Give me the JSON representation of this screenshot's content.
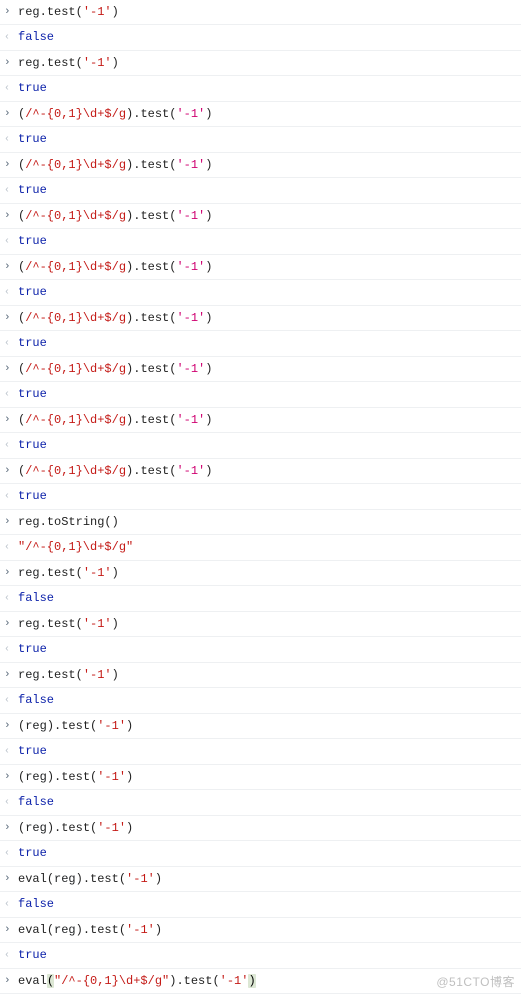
{
  "watermark": "@51CTO博客",
  "lines": [
    {
      "dir": "in",
      "parts": [
        {
          "t": "ident",
          "v": "reg"
        },
        {
          "t": "dot",
          "v": "."
        },
        {
          "t": "method",
          "v": "test"
        },
        {
          "t": "paren",
          "v": "("
        },
        {
          "t": "string-red",
          "v": "'-1'"
        },
        {
          "t": "paren",
          "v": ")"
        }
      ]
    },
    {
      "dir": "out",
      "parts": [
        {
          "t": "kw-false",
          "v": "false"
        }
      ]
    },
    {
      "dir": "in",
      "parts": [
        {
          "t": "ident",
          "v": "reg"
        },
        {
          "t": "dot",
          "v": "."
        },
        {
          "t": "method",
          "v": "test"
        },
        {
          "t": "paren",
          "v": "("
        },
        {
          "t": "string-red",
          "v": "'-1'"
        },
        {
          "t": "paren",
          "v": ")"
        }
      ]
    },
    {
      "dir": "out",
      "parts": [
        {
          "t": "kw-true",
          "v": "true"
        }
      ]
    },
    {
      "dir": "in",
      "parts": [
        {
          "t": "paren",
          "v": "("
        },
        {
          "t": "regex",
          "v": "/^-{0,1}\\d+$/g"
        },
        {
          "t": "paren",
          "v": ")"
        },
        {
          "t": "dot",
          "v": "."
        },
        {
          "t": "method",
          "v": "test"
        },
        {
          "t": "paren",
          "v": "("
        },
        {
          "t": "string-pink",
          "v": "'-1'"
        },
        {
          "t": "paren",
          "v": ")"
        }
      ]
    },
    {
      "dir": "out",
      "parts": [
        {
          "t": "kw-true",
          "v": "true"
        }
      ]
    },
    {
      "dir": "in",
      "parts": [
        {
          "t": "paren",
          "v": "("
        },
        {
          "t": "regex",
          "v": "/^-{0,1}\\d+$/g"
        },
        {
          "t": "paren",
          "v": ")"
        },
        {
          "t": "dot",
          "v": "."
        },
        {
          "t": "method",
          "v": "test"
        },
        {
          "t": "paren",
          "v": "("
        },
        {
          "t": "string-pink",
          "v": "'-1'"
        },
        {
          "t": "paren",
          "v": ")"
        }
      ]
    },
    {
      "dir": "out",
      "parts": [
        {
          "t": "kw-true",
          "v": "true"
        }
      ]
    },
    {
      "dir": "in",
      "parts": [
        {
          "t": "paren",
          "v": "("
        },
        {
          "t": "regex",
          "v": "/^-{0,1}\\d+$/g"
        },
        {
          "t": "paren",
          "v": ")"
        },
        {
          "t": "dot",
          "v": "."
        },
        {
          "t": "method",
          "v": "test"
        },
        {
          "t": "paren",
          "v": "("
        },
        {
          "t": "string-pink",
          "v": "'-1'"
        },
        {
          "t": "paren",
          "v": ")"
        }
      ]
    },
    {
      "dir": "out",
      "parts": [
        {
          "t": "kw-true",
          "v": "true"
        }
      ]
    },
    {
      "dir": "in",
      "parts": [
        {
          "t": "paren",
          "v": "("
        },
        {
          "t": "regex",
          "v": "/^-{0,1}\\d+$/g"
        },
        {
          "t": "paren",
          "v": ")"
        },
        {
          "t": "dot",
          "v": "."
        },
        {
          "t": "method",
          "v": "test"
        },
        {
          "t": "paren",
          "v": "("
        },
        {
          "t": "string-pink",
          "v": "'-1'"
        },
        {
          "t": "paren",
          "v": ")"
        }
      ]
    },
    {
      "dir": "out",
      "parts": [
        {
          "t": "kw-true",
          "v": "true"
        }
      ]
    },
    {
      "dir": "in",
      "parts": [
        {
          "t": "paren",
          "v": "("
        },
        {
          "t": "regex",
          "v": "/^-{0,1}\\d+$/g"
        },
        {
          "t": "paren",
          "v": ")"
        },
        {
          "t": "dot",
          "v": "."
        },
        {
          "t": "method",
          "v": "test"
        },
        {
          "t": "paren",
          "v": "("
        },
        {
          "t": "string-pink",
          "v": "'-1'"
        },
        {
          "t": "paren",
          "v": ")"
        }
      ]
    },
    {
      "dir": "out",
      "parts": [
        {
          "t": "kw-true",
          "v": "true"
        }
      ]
    },
    {
      "dir": "in",
      "parts": [
        {
          "t": "paren",
          "v": "("
        },
        {
          "t": "regex",
          "v": "/^-{0,1}\\d+$/g"
        },
        {
          "t": "paren",
          "v": ")"
        },
        {
          "t": "dot",
          "v": "."
        },
        {
          "t": "method",
          "v": "test"
        },
        {
          "t": "paren",
          "v": "("
        },
        {
          "t": "string-pink",
          "v": "'-1'"
        },
        {
          "t": "paren",
          "v": ")"
        }
      ]
    },
    {
      "dir": "out",
      "parts": [
        {
          "t": "kw-true",
          "v": "true"
        }
      ]
    },
    {
      "dir": "in",
      "parts": [
        {
          "t": "paren",
          "v": "("
        },
        {
          "t": "regex",
          "v": "/^-{0,1}\\d+$/g"
        },
        {
          "t": "paren",
          "v": ")"
        },
        {
          "t": "dot",
          "v": "."
        },
        {
          "t": "method",
          "v": "test"
        },
        {
          "t": "paren",
          "v": "("
        },
        {
          "t": "string-pink",
          "v": "'-1'"
        },
        {
          "t": "paren",
          "v": ")"
        }
      ]
    },
    {
      "dir": "out",
      "parts": [
        {
          "t": "kw-true",
          "v": "true"
        }
      ]
    },
    {
      "dir": "in",
      "parts": [
        {
          "t": "paren",
          "v": "("
        },
        {
          "t": "regex",
          "v": "/^-{0,1}\\d+$/g"
        },
        {
          "t": "paren",
          "v": ")"
        },
        {
          "t": "dot",
          "v": "."
        },
        {
          "t": "method",
          "v": "test"
        },
        {
          "t": "paren",
          "v": "("
        },
        {
          "t": "string-pink",
          "v": "'-1'"
        },
        {
          "t": "paren",
          "v": ")"
        }
      ]
    },
    {
      "dir": "out",
      "parts": [
        {
          "t": "kw-true",
          "v": "true"
        }
      ]
    },
    {
      "dir": "in",
      "parts": [
        {
          "t": "ident",
          "v": "reg"
        },
        {
          "t": "dot",
          "v": "."
        },
        {
          "t": "method",
          "v": "toString"
        },
        {
          "t": "paren",
          "v": "("
        },
        {
          "t": "paren",
          "v": ")"
        }
      ]
    },
    {
      "dir": "out",
      "parts": [
        {
          "t": "string-red",
          "v": "\"/^-{0,1}\\d+$/g\""
        }
      ]
    },
    {
      "dir": "in",
      "parts": [
        {
          "t": "ident",
          "v": "reg"
        },
        {
          "t": "dot",
          "v": "."
        },
        {
          "t": "method",
          "v": "test"
        },
        {
          "t": "paren",
          "v": "("
        },
        {
          "t": "string-red",
          "v": "'-1'"
        },
        {
          "t": "paren",
          "v": ")"
        }
      ]
    },
    {
      "dir": "out",
      "parts": [
        {
          "t": "kw-false",
          "v": "false"
        }
      ]
    },
    {
      "dir": "in",
      "parts": [
        {
          "t": "ident",
          "v": "reg"
        },
        {
          "t": "dot",
          "v": "."
        },
        {
          "t": "method",
          "v": "test"
        },
        {
          "t": "paren",
          "v": "("
        },
        {
          "t": "string-red",
          "v": "'-1'"
        },
        {
          "t": "paren",
          "v": ")"
        }
      ]
    },
    {
      "dir": "out",
      "parts": [
        {
          "t": "kw-true",
          "v": "true"
        }
      ]
    },
    {
      "dir": "in",
      "parts": [
        {
          "t": "ident",
          "v": "reg"
        },
        {
          "t": "dot",
          "v": "."
        },
        {
          "t": "method",
          "v": "test"
        },
        {
          "t": "paren",
          "v": "("
        },
        {
          "t": "string-red",
          "v": "'-1'"
        },
        {
          "t": "paren",
          "v": ")"
        }
      ]
    },
    {
      "dir": "out",
      "parts": [
        {
          "t": "kw-false",
          "v": "false"
        }
      ]
    },
    {
      "dir": "in",
      "parts": [
        {
          "t": "paren",
          "v": "("
        },
        {
          "t": "ident",
          "v": "reg"
        },
        {
          "t": "paren",
          "v": ")"
        },
        {
          "t": "dot",
          "v": "."
        },
        {
          "t": "method",
          "v": "test"
        },
        {
          "t": "paren",
          "v": "("
        },
        {
          "t": "string-red",
          "v": "'-1'"
        },
        {
          "t": "paren",
          "v": ")"
        }
      ]
    },
    {
      "dir": "out",
      "parts": [
        {
          "t": "kw-true",
          "v": "true"
        }
      ]
    },
    {
      "dir": "in",
      "parts": [
        {
          "t": "paren",
          "v": "("
        },
        {
          "t": "ident",
          "v": "reg"
        },
        {
          "t": "paren",
          "v": ")"
        },
        {
          "t": "dot",
          "v": "."
        },
        {
          "t": "method",
          "v": "test"
        },
        {
          "t": "paren",
          "v": "("
        },
        {
          "t": "string-red",
          "v": "'-1'"
        },
        {
          "t": "paren",
          "v": ")"
        }
      ]
    },
    {
      "dir": "out",
      "parts": [
        {
          "t": "kw-false",
          "v": "false"
        }
      ]
    },
    {
      "dir": "in",
      "parts": [
        {
          "t": "paren",
          "v": "("
        },
        {
          "t": "ident",
          "v": "reg"
        },
        {
          "t": "paren",
          "v": ")"
        },
        {
          "t": "dot",
          "v": "."
        },
        {
          "t": "method",
          "v": "test"
        },
        {
          "t": "paren",
          "v": "("
        },
        {
          "t": "string-red",
          "v": "'-1'"
        },
        {
          "t": "paren",
          "v": ")"
        }
      ]
    },
    {
      "dir": "out",
      "parts": [
        {
          "t": "kw-true",
          "v": "true"
        }
      ]
    },
    {
      "dir": "in",
      "parts": [
        {
          "t": "method",
          "v": "eval"
        },
        {
          "t": "paren",
          "v": "("
        },
        {
          "t": "ident",
          "v": "reg"
        },
        {
          "t": "paren",
          "v": ")"
        },
        {
          "t": "dot",
          "v": "."
        },
        {
          "t": "method",
          "v": "test"
        },
        {
          "t": "paren",
          "v": "("
        },
        {
          "t": "string-red",
          "v": "'-1'"
        },
        {
          "t": "paren",
          "v": ")"
        }
      ]
    },
    {
      "dir": "out",
      "parts": [
        {
          "t": "kw-false",
          "v": "false"
        }
      ]
    },
    {
      "dir": "in",
      "parts": [
        {
          "t": "method",
          "v": "eval"
        },
        {
          "t": "paren",
          "v": "("
        },
        {
          "t": "ident",
          "v": "reg"
        },
        {
          "t": "paren",
          "v": ")"
        },
        {
          "t": "dot",
          "v": "."
        },
        {
          "t": "method",
          "v": "test"
        },
        {
          "t": "paren",
          "v": "("
        },
        {
          "t": "string-red",
          "v": "'-1'"
        },
        {
          "t": "paren",
          "v": ")"
        }
      ]
    },
    {
      "dir": "out",
      "parts": [
        {
          "t": "kw-true",
          "v": "true"
        }
      ]
    },
    {
      "dir": "in",
      "parts": [
        {
          "t": "method",
          "v": "eval"
        },
        {
          "t": "paren-hl",
          "v": "("
        },
        {
          "t": "string-red",
          "v": "\"/^-{0,1}\\d+$/g\""
        },
        {
          "t": "paren",
          "v": ")"
        },
        {
          "t": "dot",
          "v": "."
        },
        {
          "t": "method",
          "v": "test"
        },
        {
          "t": "paren",
          "v": "("
        },
        {
          "t": "string-red",
          "v": "'-1'"
        },
        {
          "t": "paren-hl",
          "v": ")"
        }
      ]
    }
  ]
}
